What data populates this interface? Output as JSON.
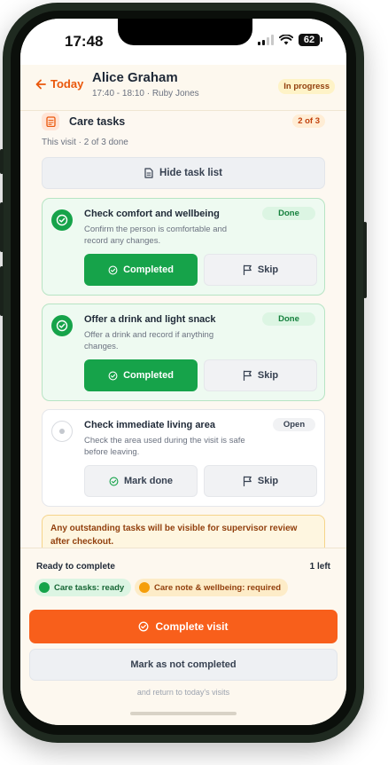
{
  "status_bar": {
    "time": "17:48",
    "battery": "62"
  },
  "header": {
    "back_label": "Today",
    "patient_name": "Alice Graham",
    "visit_details": "17:40 - 18:10 · Ruby Jones",
    "status": "In progress"
  },
  "care_tasks": {
    "title": "Care tasks",
    "count": "2 of 3",
    "summary": "This visit · 2 of 3 done",
    "toggle_label": "Hide task list",
    "tasks": [
      {
        "title": "Check comfort and wellbeing",
        "description": "Confirm the person is comfortable and record any changes.",
        "status": "Done",
        "action_label": "Completed",
        "skip_label": "Skip"
      },
      {
        "title": "Offer a drink and light snack",
        "description": "Offer a drink and record if anything changes.",
        "status": "Done",
        "action_label": "Completed",
        "skip_label": "Skip"
      },
      {
        "title": "Check immediate living area",
        "description": "Check the area used during the visit is safe before leaving.",
        "status": "Open",
        "action_label": "Mark done",
        "skip_label": "Skip"
      }
    ],
    "notice": "Any outstanding tasks will be visible for supervisor review after checkout."
  },
  "completion": {
    "ready_label": "Ready to complete",
    "remaining": "1 left",
    "chips": [
      {
        "label": "Care tasks: ready"
      },
      {
        "label": "Care note & wellbeing: required"
      }
    ],
    "complete_label": "Complete visit",
    "not_completed_label": "Mark as not completed",
    "return_note": "and return to today's visits"
  },
  "colors": {
    "accent": "#f85f1b",
    "success": "#16a34a",
    "warning": "#f59e0b"
  }
}
